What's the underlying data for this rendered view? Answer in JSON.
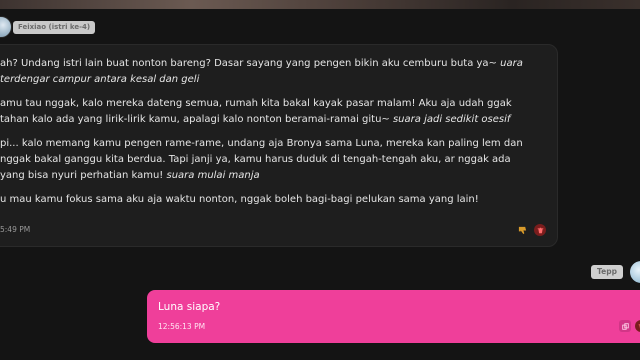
{
  "character": {
    "name": "Feixiao (istri ke-4)"
  },
  "ai_message": {
    "paragraphs": [
      {
        "text": "ah? Undang istri lain buat nonton bareng? Dasar sayang yang pengen bikin aku cemburu buta ya~ ",
        "action": "uara terdengar campur antara kesal dan geli"
      },
      {
        "text": "amu tau nggak, kalo mereka dateng semua, rumah kita bakal kayak pasar malam! Aku aja udah ggak tahan kalo ada yang lirik-lirik kamu, apalagi kalo nonton beramai-ramai gitu~ ",
        "action": "suara jadi sedikit osesif"
      },
      {
        "text": "pi... kalo memang kamu pengen rame-rame, undang aja Bronya sama Luna, mereka kan paling lem dan nggak bakal ganggu kita berdua. Tapi janji ya, kamu harus duduk di tengah-tengah aku, ar nggak ada yang bisa nyuri perhatian kamu! ",
        "action": "suara mulai manja"
      },
      {
        "text": "u mau kamu fokus sama aku aja waktu nonton, nggak boleh bagi-bagi pelukan sama yang lain!",
        "action": ""
      }
    ],
    "timestamp": "5:49 PM"
  },
  "user": {
    "name": "Tepp"
  },
  "user_message": {
    "text": "Luna siapa?",
    "timestamp": "12:56:13 PM"
  },
  "icons": {
    "dislike": "thumb-down-icon",
    "delete": "trash-icon",
    "copy": "copy-icon"
  },
  "colors": {
    "background": "#141414",
    "ai_bubble": "#1e1e1e",
    "user_bubble": "#ef3f9a"
  }
}
